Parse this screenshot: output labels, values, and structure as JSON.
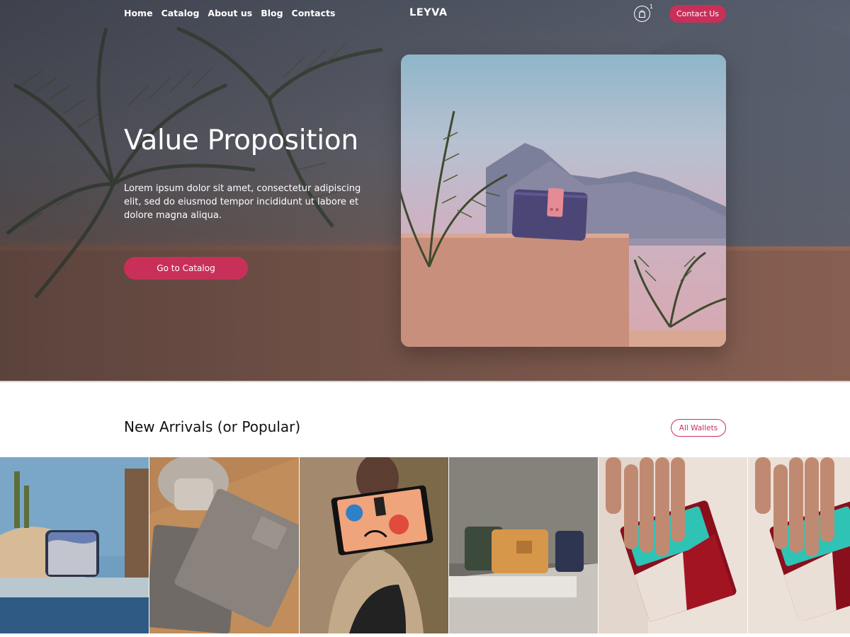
{
  "nav": {
    "links": [
      "Home",
      "Catalog",
      "About us",
      "Blog",
      "Contacts"
    ],
    "brand": "LEYVA",
    "cart_count": "1",
    "contact_label": "Contact Us"
  },
  "hero": {
    "title": "Value Proposition",
    "description": "Lorem ipsum dolor sit amet, consectetur adipiscing elit, sed do eiusmod tempor incididunt ut labore et dolore magna aliqua.",
    "cta_label": "Go to Catalog"
  },
  "section": {
    "title": "New Arrivals (or Popular)",
    "all_label": "All Wallets"
  },
  "colors": {
    "accent": "#c8305a"
  },
  "icons": {
    "cart": "shopping-bag-icon"
  }
}
